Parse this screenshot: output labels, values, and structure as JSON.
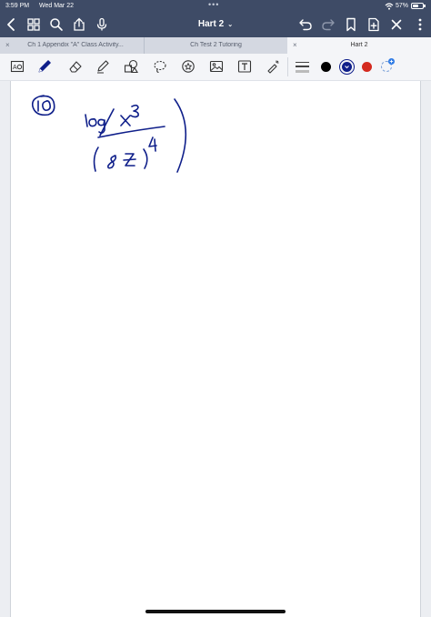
{
  "status_bar": {
    "time": "3:59 PM",
    "date": "Wed Mar 22",
    "dots": "•••",
    "battery_percent": "57%",
    "battery_level": 0.57
  },
  "nav_bar": {
    "title": "Hart 2",
    "title_chevron": "⌄",
    "left_icons": [
      "back-chevron-icon",
      "grid-icon",
      "search-icon",
      "share-icon",
      "microphone-icon"
    ],
    "right_icons": [
      "undo-icon",
      "redo-icon",
      "bookmark-icon",
      "add-page-icon",
      "close-icon",
      "more-icon"
    ]
  },
  "tabs": [
    {
      "label": "Ch 1 Appendix \"A\" Class Activity...",
      "close": "×",
      "active": false
    },
    {
      "label": "Ch Test 2 Tutoring",
      "close": "",
      "active": false
    },
    {
      "label": "Hart 2",
      "close": "×",
      "active": true
    }
  ],
  "toolbar": {
    "tools": [
      "lasso-text-icon",
      "pen-icon",
      "eraser-icon",
      "highlighter-icon",
      "shapes-icon",
      "lasso-icon",
      "sticker-icon",
      "image-icon",
      "text-box-icon",
      "laser-pointer-icon"
    ],
    "colors": [
      "#000000",
      "#0f1f8a",
      "#d42a1f"
    ],
    "selected_color": "#0f1f8a",
    "ink_color": "#0f1f8a"
  }
}
